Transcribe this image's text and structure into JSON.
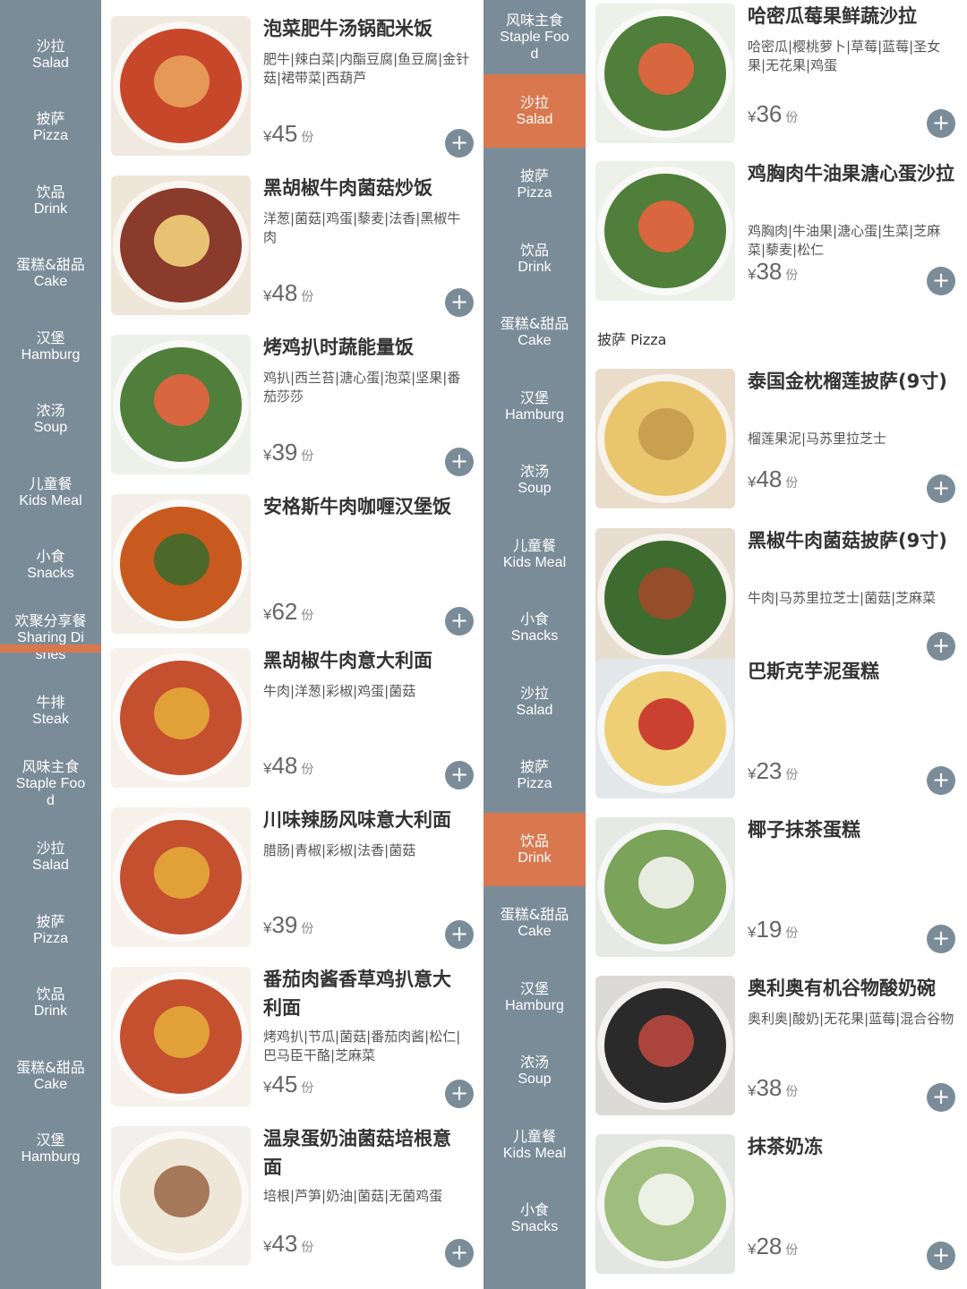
{
  "colors": {
    "sidebar": "#7b8c99",
    "active": "#d9784e",
    "add": "#7b8c99"
  },
  "left_sidebar": [
    {
      "zh": "沙拉",
      "en": "Salad"
    },
    {
      "zh": "披萨",
      "en": "Pizza"
    },
    {
      "zh": "饮品",
      "en": "Drink"
    },
    {
      "zh": "蛋糕&甜品",
      "en": "Cake"
    },
    {
      "zh": "汉堡",
      "en": "Hamburg"
    },
    {
      "zh": "浓汤",
      "en": "Soup"
    },
    {
      "zh": "儿童餐",
      "en": "Kids Meal"
    },
    {
      "zh": "小食",
      "en": "Snacks"
    },
    {
      "zh": "欢聚分享餐",
      "en": "Sharing Di shes"
    },
    {
      "zh": "牛排",
      "en": "Steak"
    },
    {
      "zh": "风味主食",
      "en": "Staple Foo d"
    },
    {
      "zh": "沙拉",
      "en": "Salad"
    },
    {
      "zh": "披萨",
      "en": "Pizza"
    },
    {
      "zh": "饮品",
      "en": "Drink"
    },
    {
      "zh": "蛋糕&甜品",
      "en": "Cake"
    },
    {
      "zh": "汉堡",
      "en": "Hamburg"
    }
  ],
  "middle_sidebar": [
    {
      "zh": "风味主食",
      "en": "Staple Foo d"
    },
    {
      "zh": "沙拉",
      "en": "Salad",
      "active": true
    },
    {
      "zh": "披萨",
      "en": "Pizza"
    },
    {
      "zh": "饮品",
      "en": "Drink"
    },
    {
      "zh": "蛋糕&甜品",
      "en": "Cake"
    },
    {
      "zh": "汉堡",
      "en": "Hamburg"
    },
    {
      "zh": "浓汤",
      "en": "Soup"
    },
    {
      "zh": "儿童餐",
      "en": "Kids Meal"
    },
    {
      "zh": "小食",
      "en": "Snacks"
    },
    {
      "zh": "沙拉",
      "en": "Salad"
    },
    {
      "zh": "披萨",
      "en": "Pizza"
    },
    {
      "zh": "饮品",
      "en": "Drink",
      "active": true
    },
    {
      "zh": "蛋糕&甜品",
      "en": "Cake"
    },
    {
      "zh": "汉堡",
      "en": "Hamburg"
    },
    {
      "zh": "浓汤",
      "en": "Soup"
    },
    {
      "zh": "儿童餐",
      "en": "Kids Meal"
    },
    {
      "zh": "小食",
      "en": "Snacks"
    }
  ],
  "left_items": [
    {
      "name": "泡菜肥牛汤锅配米饭",
      "desc": "肥牛|辣白菜|内酯豆腐|鱼豆腐|金针菇|裙带菜|西葫芦",
      "price": "45",
      "currency": "¥",
      "unit": "份"
    },
    {
      "name": "黑胡椒牛肉菌菇炒饭",
      "desc": "洋葱|菌菇|鸡蛋|藜麦|法香|黑椒牛肉",
      "price": "48",
      "currency": "¥",
      "unit": "份"
    },
    {
      "name": "烤鸡扒时蔬能量饭",
      "desc": "鸡扒|西兰苔|溏心蛋|泡菜|坚果|番茄莎莎",
      "price": "39",
      "currency": "¥",
      "unit": "份"
    },
    {
      "name": "安格斯牛肉咖喱汉堡饭",
      "desc": "",
      "price": "62",
      "currency": "¥",
      "unit": "份"
    },
    {
      "name": "黑胡椒牛肉意大利面",
      "desc": "牛肉|洋葱|彩椒|鸡蛋|菌菇",
      "price": "48",
      "currency": "¥",
      "unit": "份"
    },
    {
      "name": "川味辣肠风味意大利面",
      "desc": "腊肠|青椒|彩椒|法香|菌菇",
      "price": "39",
      "currency": "¥",
      "unit": "份"
    },
    {
      "name": "番茄肉酱香草鸡扒意大利面",
      "desc": "烤鸡扒|节瓜|菌菇|番茄肉酱|松仁|巴马臣干酪|芝麻菜",
      "price": "45",
      "currency": "¥",
      "unit": "份"
    },
    {
      "name": "温泉蛋奶油菌菇培根意面",
      "desc": "培根|芦笋|奶油|菌菇|无菌鸡蛋",
      "price": "43",
      "currency": "¥",
      "unit": "份"
    }
  ],
  "right_items_a": [
    {
      "name": "哈密瓜莓果鲜蔬沙拉",
      "desc": "哈密瓜|樱桃萝卜|草莓|蓝莓|圣女果|无花果|鸡蛋",
      "price": "36",
      "currency": "¥",
      "unit": "份"
    },
    {
      "name": "鸡胸肉牛油果溏心蛋沙拉",
      "desc": "鸡胸肉|牛油果|溏心蛋|生菜|芝麻菜|藜麦|松仁",
      "price": "38",
      "currency": "¥",
      "unit": "份"
    }
  ],
  "right_section_title": "披萨 Pizza",
  "right_items_b": [
    {
      "name": "泰国金枕榴莲披萨(9寸)",
      "desc": "榴莲果泥|马苏里拉芝士",
      "price": "48",
      "currency": "¥",
      "unit": "份"
    },
    {
      "name": "黑椒牛肉菌菇披萨(9寸)",
      "desc": "牛肉|马苏里拉芝士|菌菇|芝麻菜",
      "price": "",
      "currency": "",
      "unit": ""
    }
  ],
  "right_items_c": [
    {
      "name": "巴斯克芋泥蛋糕",
      "desc": "",
      "price": "23",
      "currency": "¥",
      "unit": "份"
    },
    {
      "name": "椰子抹茶蛋糕",
      "desc": "",
      "price": "19",
      "currency": "¥",
      "unit": "份"
    },
    {
      "name": "奥利奥有机谷物酸奶碗",
      "desc": "奥利奥|酸奶|无花果|蓝莓|混合谷物",
      "price": "38",
      "currency": "¥",
      "unit": "份"
    },
    {
      "name": "抹茶奶冻",
      "desc": "",
      "price": "28",
      "currency": "¥",
      "unit": "份"
    }
  ],
  "add_label": "+"
}
